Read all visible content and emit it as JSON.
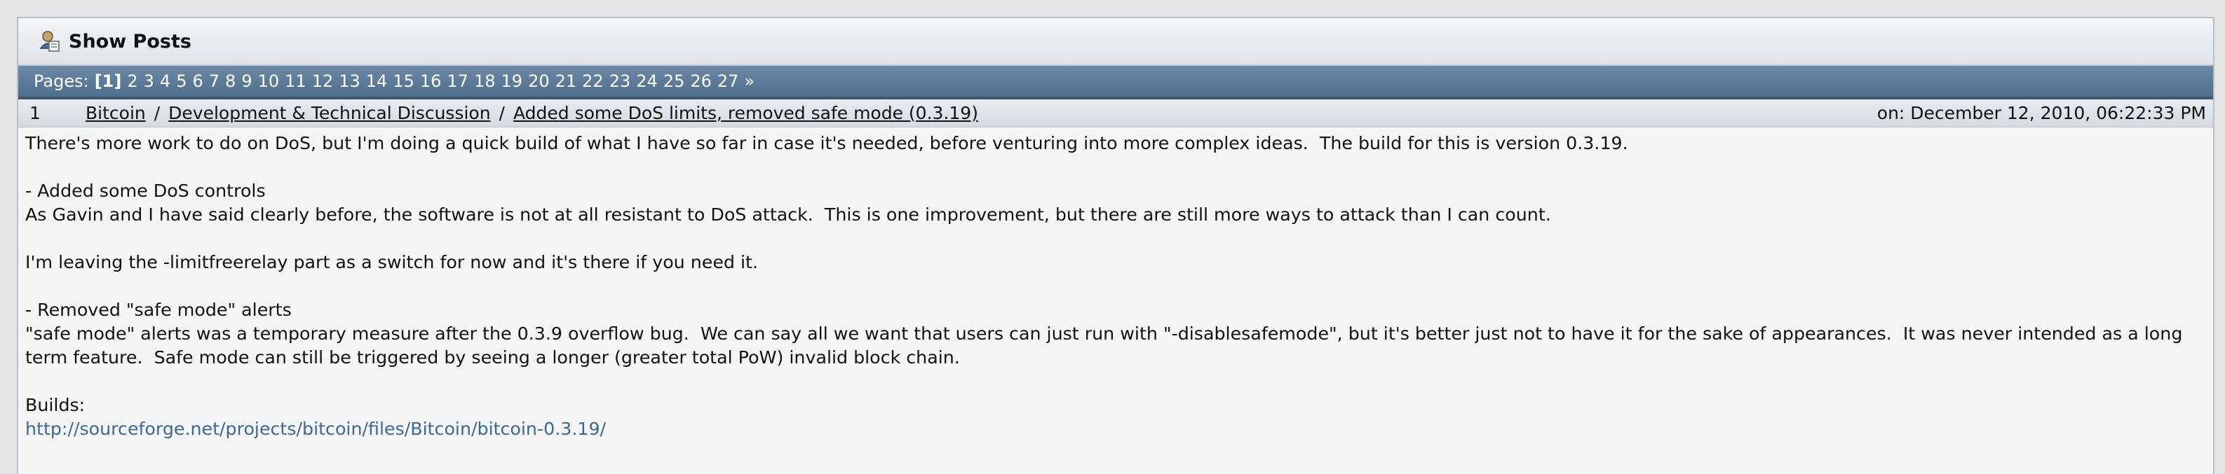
{
  "category": {
    "title": "Show Posts"
  },
  "pagination": {
    "label": "Pages:",
    "current": "1",
    "pages": [
      "2",
      "3",
      "4",
      "5",
      "6",
      "7",
      "8",
      "9",
      "10",
      "11",
      "12",
      "13",
      "14",
      "15",
      "16",
      "17",
      "18",
      "19",
      "20",
      "21",
      "22",
      "23",
      "24",
      "25",
      "26",
      "27"
    ],
    "next": "»"
  },
  "post": {
    "number": "1",
    "breadcrumb": [
      "Bitcoin",
      "Development & Technical Discussion",
      "Added some DoS limits, removed safe mode (0.3.19)"
    ],
    "separator": "/",
    "date": "on: December 12, 2010, 06:22:33 PM",
    "body": {
      "p1": "There's more work to do on DoS, but I'm doing a quick build of what I have so far in case it's needed, before venturing into more complex ideas.  The build for this is version 0.3.19.",
      "h1": "- Added some DoS controls",
      "p2": "As Gavin and I have said clearly before, the software is not at all resistant to DoS attack.  This is one improvement, but there are still more ways to attack than I can count.",
      "p3": "I'm leaving the -limitfreerelay part as a switch for now and it's there if you need it.",
      "h2": "- Removed \"safe mode\" alerts",
      "p4": "\"safe mode\" alerts was a temporary measure after the 0.3.9 overflow bug.  We can say all we want that users can just run with \"-disablesafemode\", but it's better just not to have it for the sake of appearances.  It was never intended as a long term feature.  Safe mode can still be triggered by seeing a longer (greater total PoW) invalid block chain.",
      "builds_label": "Builds:",
      "link": "http://sourceforge.net/projects/bitcoin/files/Bitcoin/bitcoin-0.3.19/"
    }
  },
  "icons": {
    "category": "user-posts-icon"
  },
  "colors": {
    "pages_bar": "#5a7896",
    "link": "#3c6a93"
  }
}
